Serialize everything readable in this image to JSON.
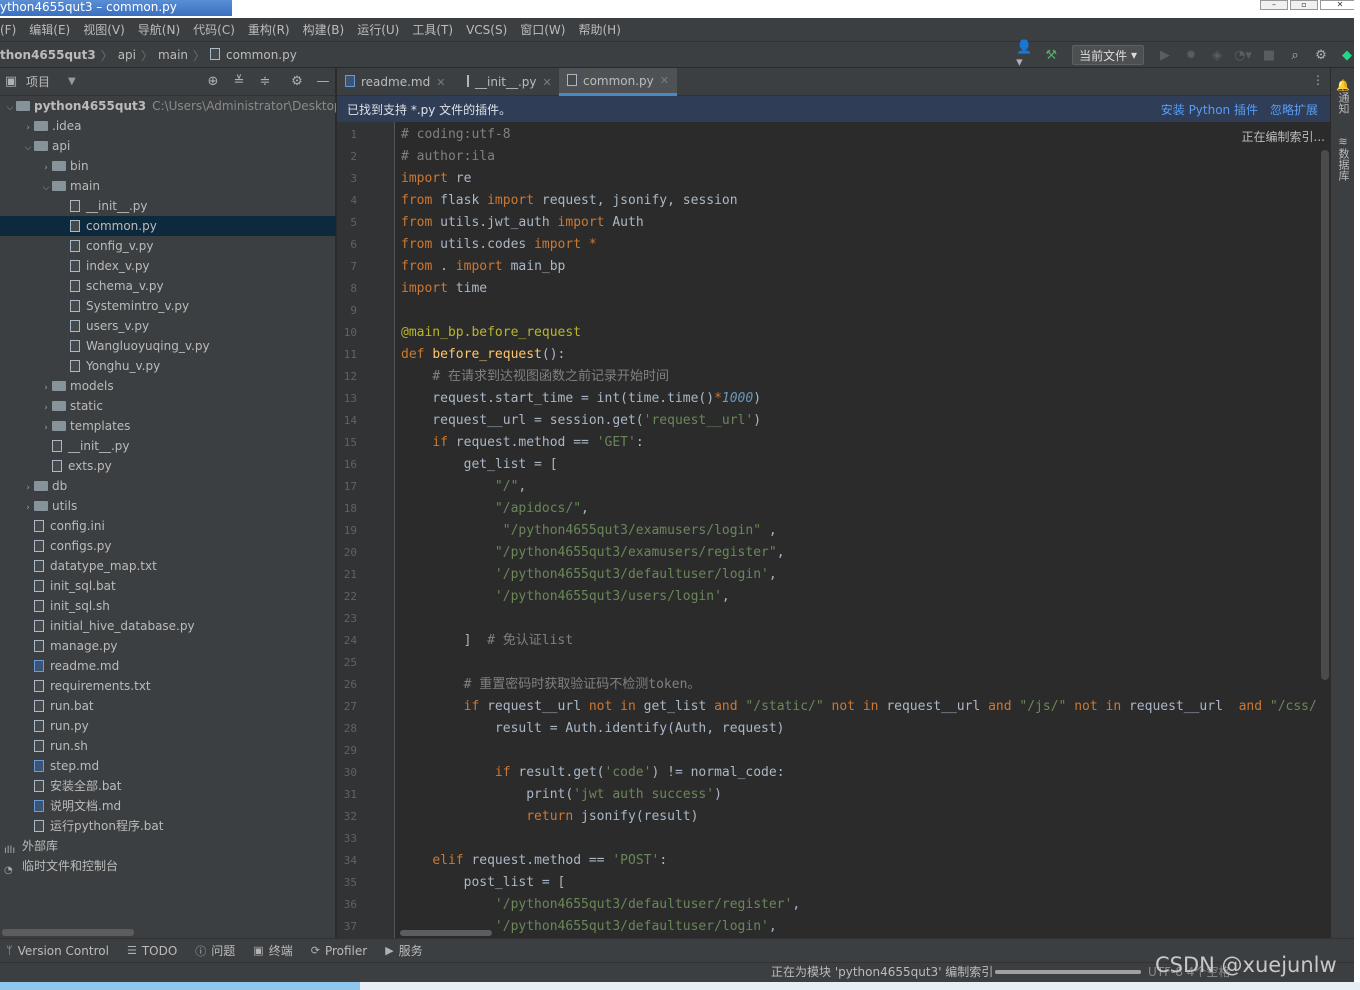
{
  "window": {
    "title": "ython4655qut3 – common.py"
  },
  "menu": [
    "(F)",
    "编辑(E)",
    "视图(V)",
    "导航(N)",
    "代码(C)",
    "重构(R)",
    "构建(B)",
    "运行(U)",
    "工具(T)",
    "VCS(S)",
    "窗口(W)",
    "帮助(H)"
  ],
  "breadcrumb": [
    "thon4655qut3",
    "api",
    "main",
    "common.py"
  ],
  "toolbar": {
    "run_config": "当前文件"
  },
  "project_panel": {
    "title": "项目",
    "rows": [
      {
        "label": "python4655qut3",
        "extra": "C:\\Users\\Administrator\\Desktop\\新",
        "type": "folder",
        "depth": 0,
        "expanded": true,
        "bold": true
      },
      {
        "label": ".idea",
        "type": "folder",
        "depth": 1,
        "expanded": false
      },
      {
        "label": "api",
        "type": "folder",
        "depth": 1,
        "expanded": true
      },
      {
        "label": "bin",
        "type": "folder",
        "depth": 2,
        "expanded": false
      },
      {
        "label": "main",
        "type": "folder",
        "depth": 2,
        "expanded": true
      },
      {
        "label": "__init__.py",
        "type": "file",
        "depth": 3
      },
      {
        "label": "common.py",
        "type": "file",
        "depth": 3,
        "selected": true
      },
      {
        "label": "config_v.py",
        "type": "file",
        "depth": 3
      },
      {
        "label": "index_v.py",
        "type": "file",
        "depth": 3
      },
      {
        "label": "schema_v.py",
        "type": "file",
        "depth": 3
      },
      {
        "label": "Systemintro_v.py",
        "type": "file",
        "depth": 3
      },
      {
        "label": "users_v.py",
        "type": "file",
        "depth": 3
      },
      {
        "label": "Wangluoyuqing_v.py",
        "type": "file",
        "depth": 3
      },
      {
        "label": "Yonghu_v.py",
        "type": "file",
        "depth": 3
      },
      {
        "label": "models",
        "type": "folder",
        "depth": 2,
        "expanded": false
      },
      {
        "label": "static",
        "type": "folder",
        "depth": 2,
        "expanded": false
      },
      {
        "label": "templates",
        "type": "folder",
        "depth": 2,
        "expanded": false
      },
      {
        "label": "__init__.py",
        "type": "file",
        "depth": 2
      },
      {
        "label": "exts.py",
        "type": "file",
        "depth": 2
      },
      {
        "label": "db",
        "type": "folder",
        "depth": 1,
        "expanded": false
      },
      {
        "label": "utils",
        "type": "folder",
        "depth": 1,
        "expanded": false
      },
      {
        "label": "config.ini",
        "type": "file",
        "depth": 1
      },
      {
        "label": "configs.py",
        "type": "file",
        "depth": 1
      },
      {
        "label": "datatype_map.txt",
        "type": "file",
        "depth": 1
      },
      {
        "label": "init_sql.bat",
        "type": "file",
        "depth": 1
      },
      {
        "label": "init_sql.sh",
        "type": "file",
        "depth": 1
      },
      {
        "label": "initial_hive_database.py",
        "type": "file",
        "depth": 1
      },
      {
        "label": "manage.py",
        "type": "file",
        "depth": 1
      },
      {
        "label": "readme.md",
        "type": "md",
        "depth": 1
      },
      {
        "label": "requirements.txt",
        "type": "file",
        "depth": 1
      },
      {
        "label": "run.bat",
        "type": "file",
        "depth": 1
      },
      {
        "label": "run.py",
        "type": "file",
        "depth": 1
      },
      {
        "label": "run.sh",
        "type": "file",
        "depth": 1
      },
      {
        "label": "step.md",
        "type": "md",
        "depth": 1
      },
      {
        "label": "安装全部.bat",
        "type": "file",
        "depth": 1
      },
      {
        "label": "说明文档.md",
        "type": "md",
        "depth": 1
      },
      {
        "label": "运行python程序.bat",
        "type": "file",
        "depth": 1
      },
      {
        "label": "外部库",
        "type": "lib",
        "depth": 0
      },
      {
        "label": "临时文件和控制台",
        "type": "scratch",
        "depth": 0
      }
    ]
  },
  "tabs": [
    {
      "label": "readme.md",
      "active": false
    },
    {
      "label": "__init__.py",
      "active": false
    },
    {
      "label": "common.py",
      "active": true
    }
  ],
  "banner": {
    "text": "已找到支持 *.py 文件的插件。",
    "install": "安装 Python 插件",
    "ignore": "忽略扩展"
  },
  "indexing_popup": "正在编制索引...",
  "editor": {
    "lines": [
      [
        [
          "cm",
          "# coding:utf-8"
        ]
      ],
      [
        [
          "cm",
          "# author:ila"
        ]
      ],
      [
        [
          "kw",
          "import"
        ],
        [
          "",
          " re"
        ]
      ],
      [
        [
          "kw",
          "from"
        ],
        [
          "",
          " flask "
        ],
        [
          "kw",
          "import"
        ],
        [
          "",
          " request, jsonify, session"
        ]
      ],
      [
        [
          "kw",
          "from"
        ],
        [
          "",
          " utils.jwt_auth "
        ],
        [
          "kw",
          "import"
        ],
        [
          "",
          " Auth"
        ]
      ],
      [
        [
          "kw",
          "from"
        ],
        [
          "",
          " utils.codes "
        ],
        [
          "kw",
          "import"
        ],
        [
          "",
          " "
        ],
        [
          "kw",
          "*"
        ]
      ],
      [
        [
          "kw",
          "from"
        ],
        [
          "",
          " . "
        ],
        [
          "kw",
          "import"
        ],
        [
          "",
          " main_bp"
        ]
      ],
      [
        [
          "kw",
          "import"
        ],
        [
          "",
          " time"
        ]
      ],
      [],
      [
        [
          "dc",
          "@main_bp.before_request"
        ]
      ],
      [
        [
          "kw",
          "def"
        ],
        [
          "",
          " "
        ],
        [
          "fn",
          "before_request"
        ],
        [
          "",
          "():"
        ]
      ],
      [
        [
          "",
          "    "
        ],
        [
          "cm",
          "# 在请求到达视图函数之前记录开始时间"
        ]
      ],
      [
        [
          "",
          "    request.start_time = int(time.time()"
        ],
        [
          "kw",
          "*"
        ],
        [
          "nm",
          "1000"
        ],
        [
          "",
          ")"
        ]
      ],
      [
        [
          "",
          "    request__url = session.get("
        ],
        [
          "st",
          "'request__url'"
        ],
        [
          "",
          ")"
        ]
      ],
      [
        [
          "",
          "    "
        ],
        [
          "kw",
          "if"
        ],
        [
          "",
          " request.method == "
        ],
        [
          "st",
          "'GET'"
        ],
        [
          "",
          ":"
        ]
      ],
      [
        [
          "",
          "        get_list = ["
        ]
      ],
      [
        [
          "",
          "            "
        ],
        [
          "st",
          "\"/\""
        ],
        [
          "",
          ","
        ]
      ],
      [
        [
          "",
          "            "
        ],
        [
          "st",
          "\"/apidocs/\""
        ],
        [
          "",
          ","
        ]
      ],
      [
        [
          "",
          "             "
        ],
        [
          "st",
          "\"/python4655qut3/examusers/login\""
        ],
        [
          "",
          " ,"
        ]
      ],
      [
        [
          "",
          "            "
        ],
        [
          "st",
          "\"/python4655qut3/examusers/register\""
        ],
        [
          "",
          ","
        ]
      ],
      [
        [
          "",
          "            "
        ],
        [
          "st",
          "'/python4655qut3/defaultuser/login'"
        ],
        [
          "",
          ","
        ]
      ],
      [
        [
          "",
          "            "
        ],
        [
          "st",
          "'/python4655qut3/users/login'"
        ],
        [
          "",
          ","
        ]
      ],
      [],
      [
        [
          "",
          "        ]  "
        ],
        [
          "cm",
          "# 免认证list"
        ]
      ],
      [],
      [
        [
          "",
          "        "
        ],
        [
          "cm",
          "# 重置密码时获取验证码不检测token。"
        ]
      ],
      [
        [
          "",
          "        "
        ],
        [
          "kw",
          "if"
        ],
        [
          "",
          " request__url "
        ],
        [
          "kw",
          "not in"
        ],
        [
          "",
          " get_list "
        ],
        [
          "kw",
          "and"
        ],
        [
          "",
          " "
        ],
        [
          "st",
          "\"/static/\""
        ],
        [
          "",
          " "
        ],
        [
          "kw",
          "not in"
        ],
        [
          "",
          " request__url "
        ],
        [
          "kw",
          "and"
        ],
        [
          "",
          " "
        ],
        [
          "st",
          "\"/js/\""
        ],
        [
          "",
          " "
        ],
        [
          "kw",
          "not in"
        ],
        [
          "",
          " request__url  "
        ],
        [
          "kw",
          "and"
        ],
        [
          "",
          " "
        ],
        [
          "st",
          "\"/css/"
        ]
      ],
      [
        [
          "",
          "            result = Auth.identify(Auth, request)"
        ]
      ],
      [],
      [
        [
          "",
          "            "
        ],
        [
          "kw",
          "if"
        ],
        [
          "",
          " result.get("
        ],
        [
          "st",
          "'code'"
        ],
        [
          "",
          ") != normal_code:"
        ]
      ],
      [
        [
          "",
          "                print("
        ],
        [
          "st",
          "'jwt auth success'"
        ],
        [
          "",
          ")"
        ]
      ],
      [
        [
          "",
          "                "
        ],
        [
          "kw",
          "return"
        ],
        [
          "",
          " jsonify(result)"
        ]
      ],
      [],
      [
        [
          "",
          "    "
        ],
        [
          "kw",
          "elif"
        ],
        [
          "",
          " request.method == "
        ],
        [
          "st",
          "'POST'"
        ],
        [
          "",
          ":"
        ]
      ],
      [
        [
          "",
          "        post_list = ["
        ]
      ],
      [
        [
          "",
          "            "
        ],
        [
          "st",
          "'/python4655qut3/defaultuser/register'"
        ],
        [
          "",
          ","
        ]
      ],
      [
        [
          "",
          "            "
        ],
        [
          "st",
          "'/python4655qut3/defaultuser/login'"
        ],
        [
          "",
          ","
        ]
      ]
    ]
  },
  "right_strip": [
    "通知",
    "数据库"
  ],
  "bottom_tools": [
    {
      "icon": "version-control-icon",
      "glyph": "ᛘ",
      "label": "Version Control"
    },
    {
      "icon": "todo-icon",
      "glyph": "☰",
      "label": "TODO"
    },
    {
      "icon": "problems-icon",
      "glyph": "ⓘ",
      "label": "问题"
    },
    {
      "icon": "terminal-icon",
      "glyph": "▣",
      "label": "终端"
    },
    {
      "icon": "profiler-icon",
      "glyph": "⟳",
      "label": "Profiler"
    },
    {
      "icon": "services-icon",
      "glyph": "▶",
      "label": "服务"
    }
  ],
  "status": {
    "message": "正在为模块 'python4655qut3' 编制索引",
    "extra": "  UTF-8  4个空格",
    "progress": 1.0
  },
  "watermark": "CSDN @xuejunlw"
}
